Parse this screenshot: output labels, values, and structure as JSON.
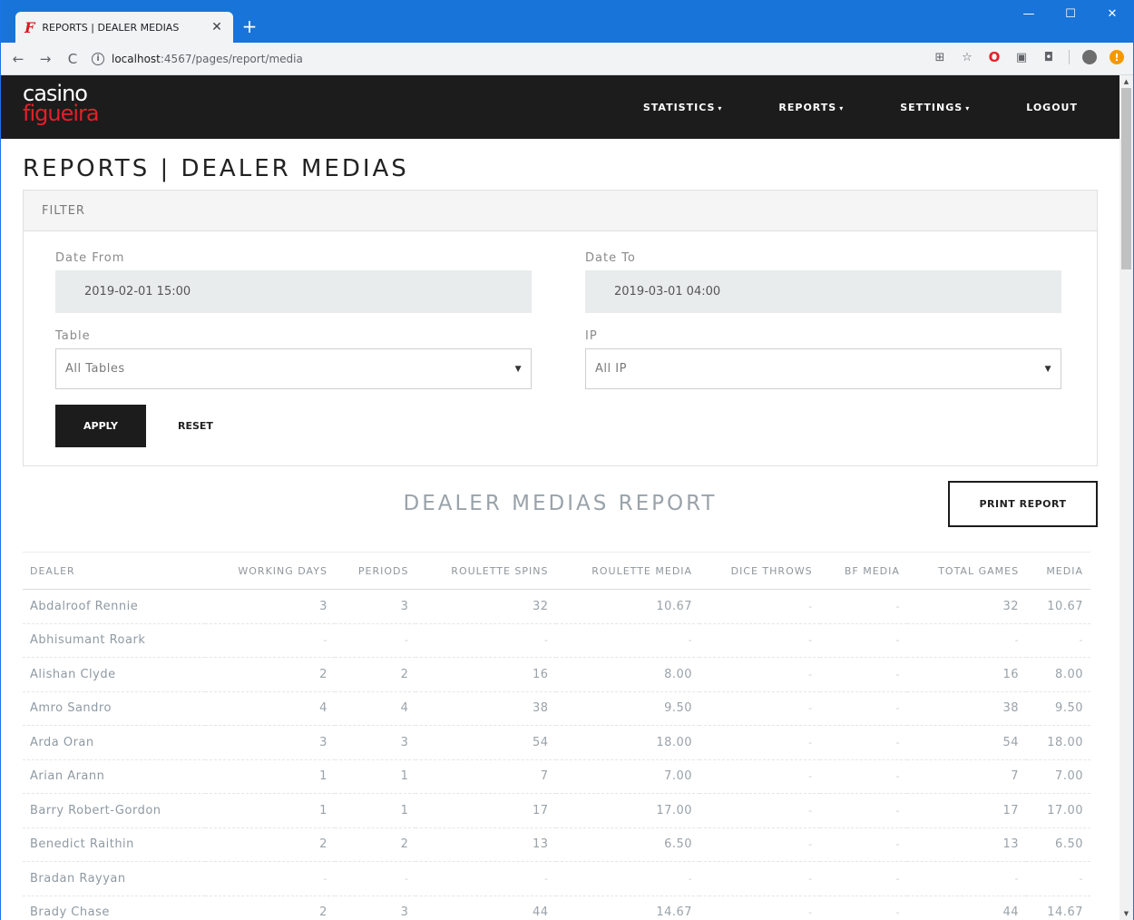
{
  "browser": {
    "tab_title": "REPORTS | DEALER MEDIAS",
    "tab_favicon": "F",
    "url_host": "localhost",
    "url_path": ":4567/pages/report/media"
  },
  "nav": {
    "logo_top": "casino",
    "logo_bottom": "figueira",
    "items": [
      "STATISTICS",
      "REPORTS",
      "SETTINGS",
      "LOGOUT"
    ]
  },
  "page": {
    "title": "REPORTS | DEALER MEDIAS"
  },
  "filter": {
    "heading": "FILTER",
    "date_from_label": "Date From",
    "date_from_value": "2019-02-01 15:00",
    "date_to_label": "Date To",
    "date_to_value": "2019-03-01 04:00",
    "table_label": "Table",
    "table_value": "All Tables",
    "ip_label": "IP",
    "ip_value": "All IP",
    "apply_label": "APPLY",
    "reset_label": "RESET"
  },
  "report": {
    "title": "DEALER MEDIAS REPORT",
    "print_label": "PRINT REPORT",
    "columns": [
      "DEALER",
      "WORKING DAYS",
      "PERIODS",
      "ROULETTE SPINS",
      "ROULETTE MEDIA",
      "DICE THROWS",
      "BF MEDIA",
      "TOTAL GAMES",
      "MEDIA"
    ],
    "rows": [
      [
        "Abdalroof Rennie",
        "3",
        "3",
        "32",
        "10.67",
        "-",
        "-",
        "32",
        "10.67"
      ],
      [
        "Abhisumant Roark",
        "-",
        "-",
        "-",
        "-",
        "-",
        "-",
        "-",
        "-"
      ],
      [
        "Alishan Clyde",
        "2",
        "2",
        "16",
        "8.00",
        "-",
        "-",
        "16",
        "8.00"
      ],
      [
        "Amro Sandro",
        "4",
        "4",
        "38",
        "9.50",
        "-",
        "-",
        "38",
        "9.50"
      ],
      [
        "Arda Oran",
        "3",
        "3",
        "54",
        "18.00",
        "-",
        "-",
        "54",
        "18.00"
      ],
      [
        "Arian Arann",
        "1",
        "1",
        "7",
        "7.00",
        "-",
        "-",
        "7",
        "7.00"
      ],
      [
        "Barry Robert-Gordon",
        "1",
        "1",
        "17",
        "17.00",
        "-",
        "-",
        "17",
        "17.00"
      ],
      [
        "Benedict Raithin",
        "2",
        "2",
        "13",
        "6.50",
        "-",
        "-",
        "13",
        "6.50"
      ],
      [
        "Bradan Rayyan",
        "-",
        "-",
        "-",
        "-",
        "-",
        "-",
        "-",
        "-"
      ],
      [
        "Brady Chase",
        "2",
        "3",
        "44",
        "14.67",
        "-",
        "-",
        "44",
        "14.67"
      ]
    ]
  }
}
